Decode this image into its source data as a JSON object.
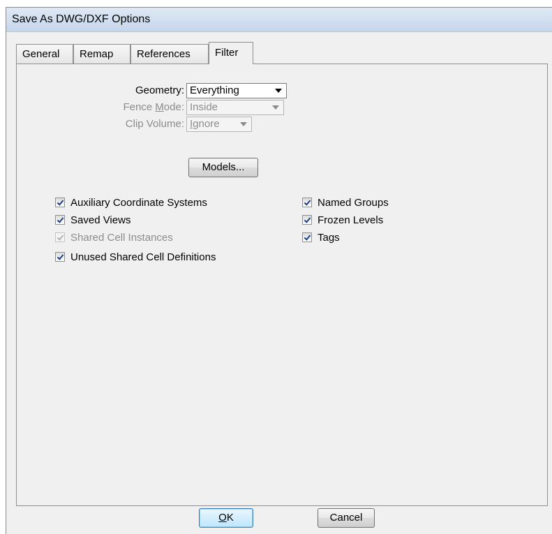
{
  "window": {
    "title": "Save As DWG/DXF Options"
  },
  "tabs": [
    {
      "label": "General"
    },
    {
      "label": "Remap"
    },
    {
      "label": "References"
    },
    {
      "label": "Filter",
      "active": true
    }
  ],
  "filter": {
    "geometry": {
      "label": "Geometry:",
      "value": "Everything"
    },
    "fence_mode": {
      "label_pre": "Fence ",
      "label_u": "M",
      "label_post": "ode:",
      "value": "Inside",
      "enabled": false
    },
    "clip_volume": {
      "label": "Clip Volume:",
      "value_u": "I",
      "value_rest": "gnore",
      "enabled": false
    },
    "models_button": "Models...",
    "checkboxes_left": [
      {
        "label": "Auxiliary Coordinate Systems",
        "checked": true,
        "enabled": true
      },
      {
        "label": "Saved Views",
        "checked": true,
        "enabled": true
      },
      {
        "label": "Shared Cell Instances",
        "checked": true,
        "enabled": false
      },
      {
        "label": "Unused Shared Cell Definitions",
        "checked": true,
        "enabled": true
      }
    ],
    "checkboxes_right": [
      {
        "label": "Named Groups",
        "checked": true,
        "enabled": true
      },
      {
        "label": "Frozen Levels",
        "checked": true,
        "enabled": true
      },
      {
        "label": "Tags",
        "checked": true,
        "enabled": true
      }
    ]
  },
  "footer": {
    "ok_u": "O",
    "ok_rest": "K",
    "cancel": "Cancel"
  },
  "colors": {
    "titlebar": "#c5d6ea",
    "dialog_bg": "#f0f0f0",
    "check_mark": "#1c3f8a",
    "disabled_text": "#8c8c8c"
  }
}
